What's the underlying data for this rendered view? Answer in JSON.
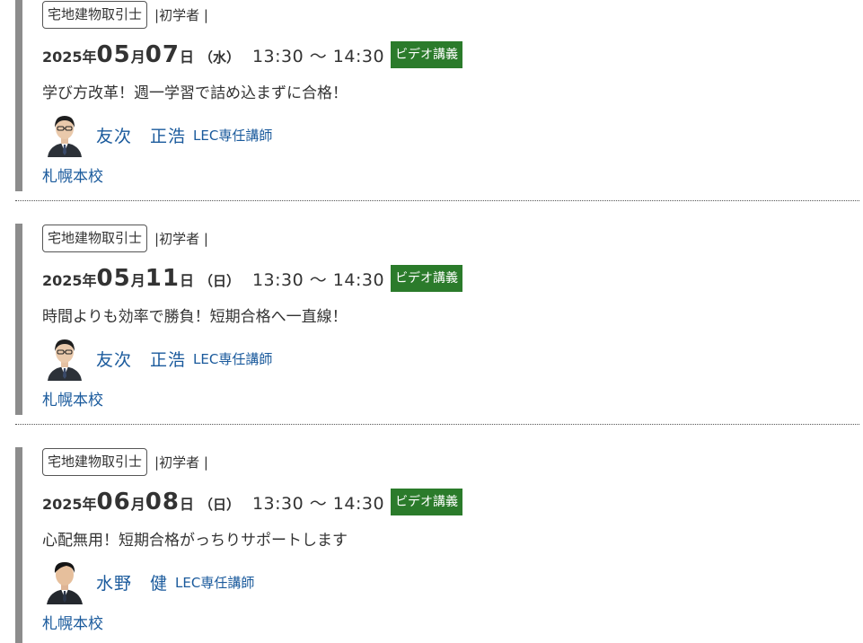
{
  "events": [
    {
      "category": "宅地建物取引士",
      "level": "|初学者 |",
      "date": {
        "year": "2025",
        "year_unit": "年",
        "month": "05",
        "month_unit": "月",
        "day": "07",
        "day_unit": "日",
        "weekday": "（水）"
      },
      "time": "13:30 ～ 14:30",
      "badge": "ビデオ講義",
      "headline": "学び方改革！週一学習で詰め込まずに合格！",
      "instructor": {
        "name": "友次　正浩",
        "title": "LEC専任講師",
        "avatar": "instructor-photo"
      },
      "school": "札幌本校"
    },
    {
      "category": "宅地建物取引士",
      "level": "|初学者 |",
      "date": {
        "year": "2025",
        "year_unit": "年",
        "month": "05",
        "month_unit": "月",
        "day": "11",
        "day_unit": "日",
        "weekday": "（日）"
      },
      "time": "13:30 ～ 14:30",
      "badge": "ビデオ講義",
      "headline": "時間よりも効率で勝負！短期合格へ一直線！",
      "instructor": {
        "name": "友次　正浩",
        "title": "LEC専任講師",
        "avatar": "instructor-photo"
      },
      "school": "札幌本校"
    },
    {
      "category": "宅地建物取引士",
      "level": "|初学者 |",
      "date": {
        "year": "2025",
        "year_unit": "年",
        "month": "06",
        "month_unit": "月",
        "day": "08",
        "day_unit": "日",
        "weekday": "（日）"
      },
      "time": "13:30 ～ 14:30",
      "badge": "ビデオ講義",
      "headline": "心配無用！短期合格がっちりサポートします",
      "instructor": {
        "name": "水野　健",
        "title": "LEC専任講師",
        "avatar": "instructor-photo"
      },
      "school": "札幌本校"
    }
  ],
  "colors": {
    "accent_bar": "#8c8c8c",
    "badge_bg": "#2b7b2b",
    "link": "#1a5a9c",
    "text": "#333333"
  }
}
